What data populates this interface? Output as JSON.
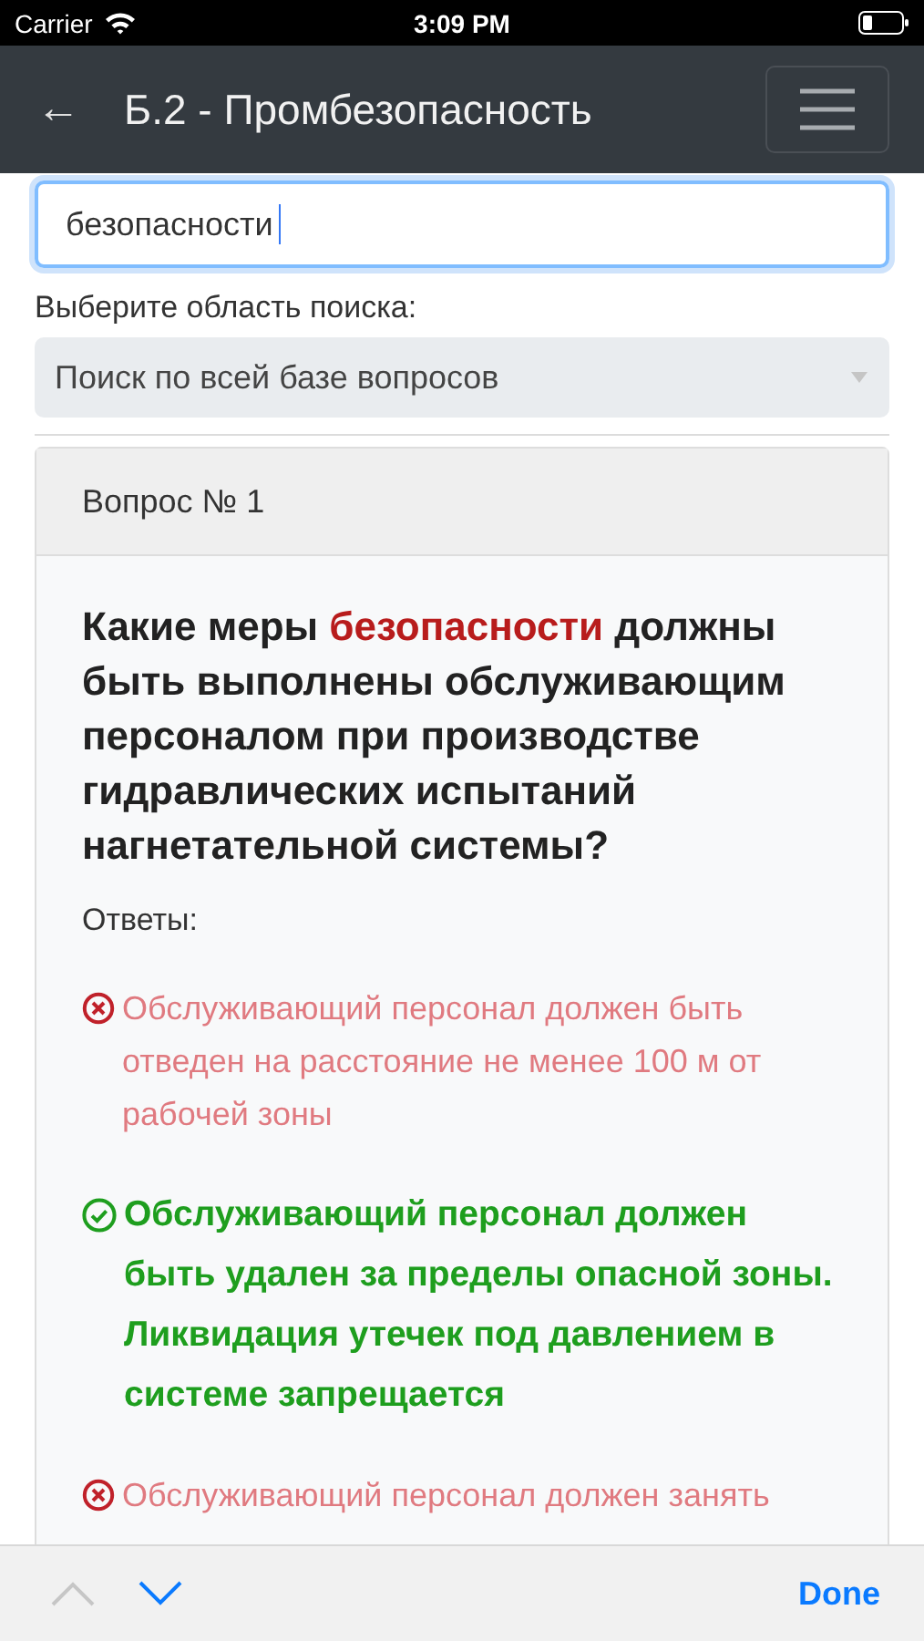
{
  "status_bar": {
    "carrier": "Carrier",
    "time": "3:09 PM"
  },
  "nav": {
    "back": "←",
    "title": "Б.2 - Промбезопасность"
  },
  "search": {
    "value": "безопасности",
    "focused": true
  },
  "scope": {
    "label": "Выберите область поиска:",
    "value": "Поиск по всей базе вопросов"
  },
  "card": {
    "header": "Вопрос № 1",
    "question": [
      {
        "text": "Какие меры ",
        "highlighted": false
      },
      {
        "text": "безопасности",
        "highlighted": true
      },
      {
        "text": " должны быть выполнены обслуживающим персоналом при производстве гидравлических испытаний нагнетательной системы?",
        "highlighted": false
      }
    ],
    "answers_label": "Ответы:",
    "answers": [
      {
        "kind": "wrong",
        "text": "Обслуживающий персонал должен быть отведен на расстояние не менее 100 м от рабочей зоны"
      },
      {
        "kind": "correct",
        "text": "Обслуживающий персонал должен быть удален за пределы опасной зоны. Ликвидация утечек под давлением в системе запрещается"
      },
      {
        "kind": "wrong",
        "text": "Обслуживающий персонал должен занять"
      }
    ]
  },
  "toolbar": {
    "prev_disabled": true,
    "next_disabled": false,
    "done": "Done"
  }
}
